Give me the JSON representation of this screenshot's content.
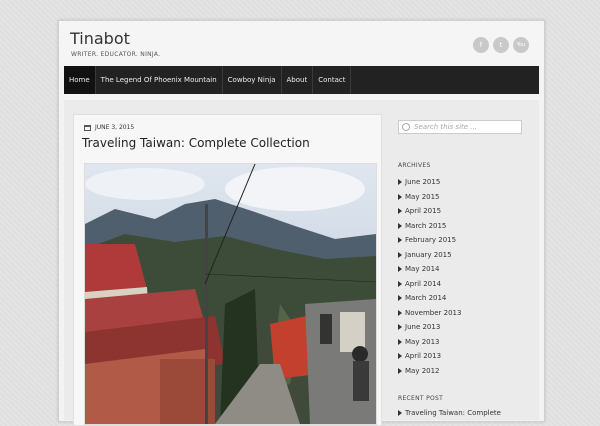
{
  "site": {
    "title": "Tinabot",
    "tagline": "WRITER. EDUCATOR. NINJA."
  },
  "social": [
    {
      "icon": "facebook-icon",
      "glyph": "f"
    },
    {
      "icon": "twitter-icon",
      "glyph": "t"
    },
    {
      "icon": "youtube-icon",
      "glyph": "You"
    }
  ],
  "nav": {
    "items": [
      "Home",
      "The Legend Of Phoenix Mountain",
      "Cowboy Ninja",
      "About",
      "Contact"
    ]
  },
  "post": {
    "date": "JUNE 3, 2015",
    "title": "Traveling Taiwan: Complete Collection"
  },
  "sidebar": {
    "search_placeholder": "Search this site ...",
    "archives_title": "ARCHIVES",
    "archives": [
      "June 2015",
      "May 2015",
      "April 2015",
      "March 2015",
      "February 2015",
      "January 2015",
      "May 2014",
      "April 2014",
      "March 2014",
      "November 2013",
      "June 2013",
      "May 2013",
      "April 2013",
      "May 2012"
    ],
    "recent_title": "RECENT POST",
    "recent": [
      "Traveling Taiwan: Complete"
    ]
  }
}
